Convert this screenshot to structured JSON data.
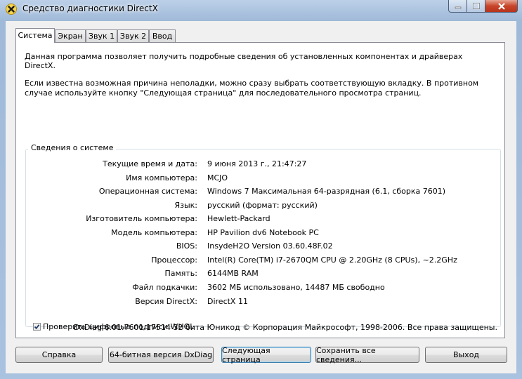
{
  "window": {
    "title": "Средство диагностики DirectX",
    "icons": {
      "app": "directx-x-icon",
      "minimize": "minimize-icon",
      "maximize": "maximize-icon",
      "close": "close-icon"
    }
  },
  "tabs": [
    {
      "label": "Система",
      "active": true
    },
    {
      "label": "Экран",
      "active": false
    },
    {
      "label": "Звук 1",
      "active": false
    },
    {
      "label": "Звук 2",
      "active": false
    },
    {
      "label": "Ввод",
      "active": false
    }
  ],
  "intro": {
    "line1": "Данная программа позволяет получить подробные сведения об установленных компонентах и драйверах DirectX.",
    "line2": "Если известна возможная причина неполадки, можно сразу выбрать соответствующую вкладку. В противном случае используйте кнопку \"Следующая страница\" для последовательного просмотра страниц."
  },
  "system_info": {
    "title": "Сведения о системе",
    "rows": [
      {
        "label": "Текущие время и дата:",
        "value": "9 июня 2013 г., 21:47:27"
      },
      {
        "label": "Имя компьютера:",
        "value": "MCJO"
      },
      {
        "label": "Операционная система:",
        "value": "Windows 7 Максимальная 64-разрядная (6.1, сборка 7601)"
      },
      {
        "label": "Язык:",
        "value": "русский (формат: русский)"
      },
      {
        "label": "Изготовитель компьютера:",
        "value": "Hewlett-Packard"
      },
      {
        "label": "Модель компьютера:",
        "value": "HP Pavilion dv6 Notebook PC"
      },
      {
        "label": "BIOS:",
        "value": "InsydeH2O Version 03.60.48F.02"
      },
      {
        "label": "Процессор:",
        "value": "Intel(R) Core(TM) i7-2670QM CPU @ 2.20GHz (8 CPUs), ~2.2GHz"
      },
      {
        "label": "Память:",
        "value": "6144MB RAM"
      },
      {
        "label": "Файл подкачки:",
        "value": "3602 МБ использовано, 14487 МБ свободно"
      },
      {
        "label": "Версия DirectX:",
        "value": "DirectX 11"
      }
    ]
  },
  "whql_check": {
    "label": "Проверить цифровые подписи WHQL",
    "checked": true
  },
  "footer": "DxDiag 6.01.7601.17514 32 бита Юникод  © Корпорация Майкрософт, 1998-2006.  Все права защищены.",
  "buttons": {
    "help": "Справка",
    "dxdiag64": "64-битная версия DxDiag",
    "next": "Следующая страница",
    "save": "Сохранить все сведения...",
    "exit": "Выход"
  }
}
